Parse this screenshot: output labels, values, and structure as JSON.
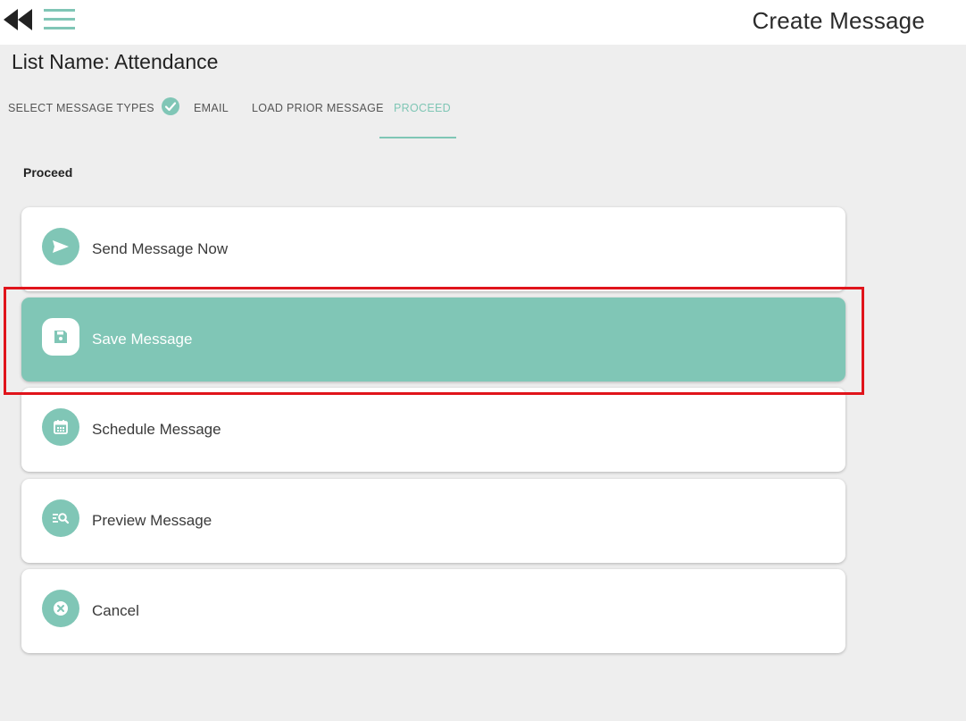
{
  "header": {
    "title": "Create Message",
    "back_icon": "double-chevron-left-icon",
    "menu_icon": "hamburger-menu-icon"
  },
  "list_name": "List Name: Attendance",
  "steps": [
    {
      "label": "SELECT MESSAGE TYPES",
      "state": "default"
    },
    {
      "label": "EMAIL",
      "state": "completed"
    },
    {
      "label": "LOAD PRIOR MESSAGE",
      "state": "default"
    },
    {
      "label": "PROCEED",
      "state": "active"
    }
  ],
  "section_label": "Proceed",
  "options": [
    {
      "label": "Send Message Now",
      "icon": "send-icon",
      "selected": false
    },
    {
      "label": "Save Message",
      "icon": "save-icon",
      "selected": true
    },
    {
      "label": "Schedule Message",
      "icon": "calendar-icon",
      "selected": false
    },
    {
      "label": "Preview Message",
      "icon": "preview-search-icon",
      "selected": false
    },
    {
      "label": "Cancel",
      "icon": "cancel-icon",
      "selected": false
    }
  ],
  "colors": {
    "accent": "#80c6b6",
    "background": "#eeeeee",
    "highlight": "#e0141b"
  }
}
